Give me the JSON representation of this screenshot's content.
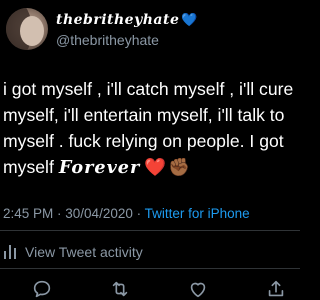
{
  "tweet": {
    "display_name": "thebritheyhate",
    "name_emoji": "💙",
    "handle": "@thebritheyhate",
    "lines": [
      "i got myself , i'll catch myself , i'll cure",
      "myself, i'll entertain myself, i'll talk to",
      "myself . fuck relying on people. I got",
      "myself"
    ],
    "fancy_word": "Forever",
    "emoji_heart": "❤️",
    "emoji_fist": "✊🏾"
  },
  "meta": {
    "time": "2:45 PM",
    "separator_1": " · ",
    "date": "30/04/2020",
    "separator_2": " · ",
    "app": "Twitter for iPhone"
  },
  "activity": {
    "label": "View Tweet activity"
  },
  "actions": [
    {
      "icon": "reply-icon"
    },
    {
      "icon": "retweet-icon"
    },
    {
      "icon": "like-icon"
    },
    {
      "icon": "share-icon"
    }
  ],
  "colors": {
    "background": "#000000",
    "text": "#ffffff",
    "secondary": "#8b98a5",
    "link": "#1d9bf0",
    "divider": "#2f3336"
  }
}
